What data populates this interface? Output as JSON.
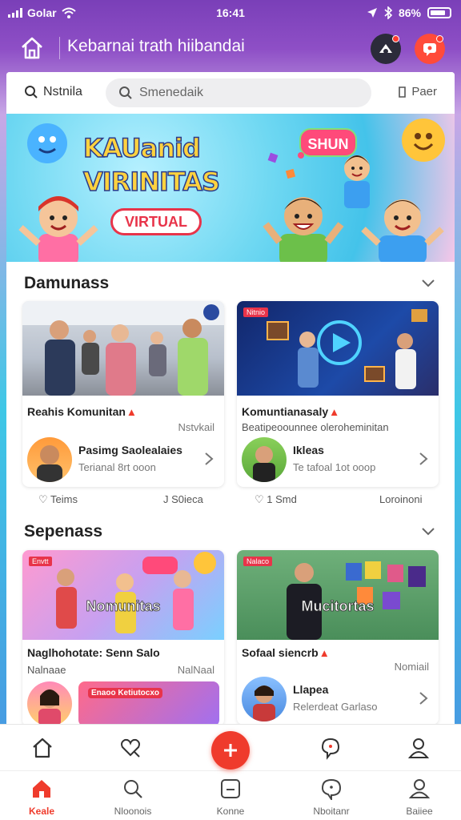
{
  "status_bar": {
    "carrier": "Golar",
    "time": "16:41",
    "battery": "86%"
  },
  "header": {
    "title": "Kebarnai trath hiibandai"
  },
  "search": {
    "left_label": "Nstnila",
    "placeholder": "Smenedaik",
    "right_label": "Paer"
  },
  "banner": {
    "title_line1": "KAUanid",
    "title_line2": "VIRINITAS",
    "pill": "VIRTUAL",
    "badge": "SHUN"
  },
  "sections": [
    {
      "title": "Damunass",
      "cards": [
        {
          "title": "Reahis Komunitan",
          "meta": "Nstvkail",
          "subtitle": "",
          "author_name": "Pasimg Saolealaies",
          "author_sub": "Terianal 8rt ooon",
          "tag": "",
          "overlay": ""
        },
        {
          "title": "Komuntianasaly",
          "meta": "",
          "subtitle": "Beatipeoounnee oleroheminitan",
          "author_name": "Ikleas",
          "author_sub": "Te tafoal 1ot ooop",
          "tag": "Nitnio",
          "overlay": ""
        }
      ],
      "footer": {
        "left": "Teims",
        "mid": "J S0ieca",
        "right_a": "1 Smd",
        "right_b": "Loroinoni"
      }
    },
    {
      "title": "Sepenass",
      "cards": [
        {
          "title": "Naglhohotate: Senn Salo",
          "meta": "NalNaal",
          "subtitle": "Nalnaae",
          "author_name": "",
          "author_sub": "",
          "tag": "Envtt",
          "overlay": "Nomunitas",
          "mini_banner": "Enaoo Ketiutocxo"
        },
        {
          "title": "Sofaal siencrb",
          "meta": "Nomiail",
          "subtitle": "",
          "author_name": "Llapea",
          "author_sub": "Relerdeat Garlaso",
          "tag": "Nalaco",
          "overlay": "Mucitortas",
          "mini_banner": ""
        }
      ]
    }
  ],
  "bottom_nav": {
    "tabs": [
      {
        "label": "Keale",
        "icon": "home-icon",
        "active": true
      },
      {
        "label": "Nloonois",
        "icon": "search-icon",
        "active": false
      },
      {
        "label": "Konne",
        "icon": "square-chat-icon",
        "active": false
      },
      {
        "label": "Nboitanr",
        "icon": "bubble-icon",
        "active": false
      },
      {
        "label": "Baiiee",
        "icon": "profile-icon",
        "active": false
      }
    ]
  },
  "colors": {
    "accent": "#ef3b2c",
    "header_gradient": "#8e4fc6",
    "banner_title": "#ffd23f"
  }
}
